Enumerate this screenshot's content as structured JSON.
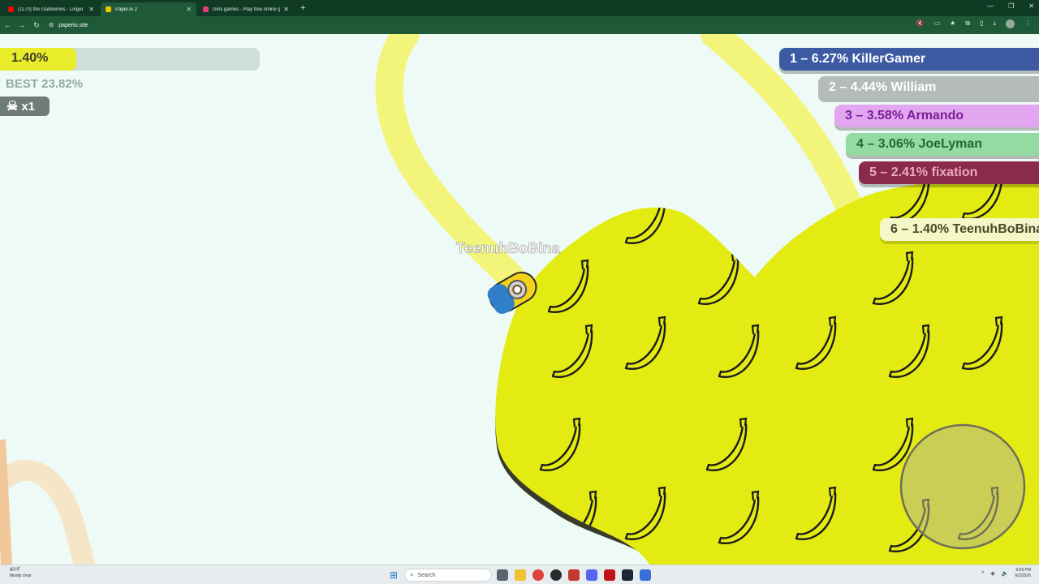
{
  "browser": {
    "tabs": [
      {
        "label": "(1170) the cranberries - Linger",
        "active": false,
        "favicon_color": "#ff0000"
      },
      {
        "label": "Paper.io 2",
        "active": true,
        "favicon_color": "#f5c400"
      },
      {
        "label": "Girls games - Play free online g",
        "active": false,
        "favicon_color": "#e53a7a"
      }
    ],
    "new_tab_label": "+",
    "url": "paperio.site"
  },
  "game": {
    "progress": {
      "label": "1.40%",
      "fraction": 0.014
    },
    "best_label": "BEST 23.82%",
    "kills_label": "x1",
    "player_name": "TeenuhBoBina",
    "territory_color": "#e3eb12",
    "trail_color": "#f2f57a",
    "leaderboard": [
      {
        "text": "1 – 6.27% KillerGamer",
        "bg": "#3b5aa2",
        "fg": "#ffffff"
      },
      {
        "text": "2 – 4.44% William",
        "bg": "#b5babb",
        "fg": "#ffffff"
      },
      {
        "text": "3 – 3.58% Armando",
        "bg": "#e2a7f0",
        "fg": "#7a1e9a"
      },
      {
        "text": "4 – 3.06% JoeLyman",
        "bg": "#93dba3",
        "fg": "#1e6b34"
      },
      {
        "text": "5 – 2.41% fixation",
        "bg": "#8a2a4d",
        "fg": "#e9a9bf"
      },
      {
        "text": "6 – 1.40% TeenuhBoBina",
        "bg": "#f4f7c7",
        "fg": "#4a4a2a"
      }
    ]
  },
  "taskbar": {
    "weather_temp": "60°F",
    "weather_desc": "Mostly clear",
    "search_placeholder": "Search",
    "time": "9:59 PM",
    "date": "6/2/2026"
  }
}
